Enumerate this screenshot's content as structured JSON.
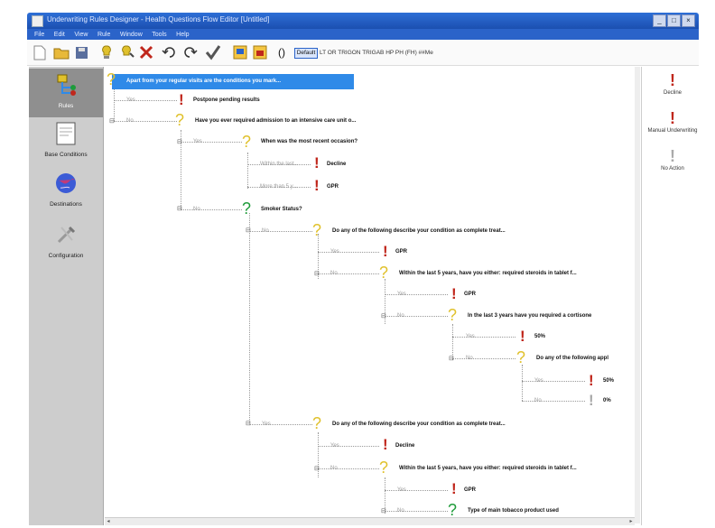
{
  "window": {
    "title": "Underwriting Rules Designer - Health Questions Flow Editor [Untitled]",
    "controls": [
      "_",
      "□",
      "×"
    ]
  },
  "menubar": {
    "items": [
      "File",
      "Edit",
      "View",
      "Rule",
      "Window",
      "Tools",
      "Help"
    ]
  },
  "toolbar": {
    "default_label": "Default",
    "format_text": "LT OR TRIGON TRIGAB HP PH (FH) ##Me"
  },
  "sidebar": {
    "items": [
      {
        "label": "Rules",
        "icon": "rules-icon",
        "selected": true
      },
      {
        "label": "Base Conditions",
        "icon": "notepad-icon",
        "selected": false
      },
      {
        "label": "Destinations",
        "icon": "globe-icon",
        "selected": false
      },
      {
        "label": "Configuration",
        "icon": "tools-icon",
        "selected": false
      }
    ]
  },
  "tree": {
    "root_question": "Apart from your regular visits are the conditions you mark...",
    "nodes": [
      {
        "id": "n1",
        "edge": "Yes",
        "type": "result",
        "text": "Postpone pending results"
      },
      {
        "id": "n2",
        "edge": "No",
        "type": "question",
        "text": "Have you ever required admission to an intensive care unit o..."
      },
      {
        "id": "n3",
        "edge": "Yes",
        "type": "question",
        "text": "When was the most recent occasion?"
      },
      {
        "id": "n4",
        "edge": "Within the last...",
        "type": "result",
        "text": "Decline"
      },
      {
        "id": "n5",
        "edge": "More than 5 y...",
        "type": "result",
        "text": "GPR"
      },
      {
        "id": "n6",
        "edge": "No",
        "type": "question-green",
        "text": "Smoker Status?"
      },
      {
        "id": "n7",
        "edge": "No",
        "type": "question",
        "text": "Do any of the following describe your condition as complete treat..."
      },
      {
        "id": "n8",
        "edge": "Yes",
        "type": "result",
        "text": "GPR"
      },
      {
        "id": "n9",
        "edge": "No",
        "type": "question",
        "text": "Within the last 5 years, have you either: required steroids in tablet f..."
      },
      {
        "id": "n10",
        "edge": "Yes",
        "type": "result",
        "text": "GPR"
      },
      {
        "id": "n11",
        "edge": "No",
        "type": "question",
        "text": "In the last 3 years have you required a cortisone"
      },
      {
        "id": "n12",
        "edge": "Yes",
        "type": "result",
        "text": "50%"
      },
      {
        "id": "n13",
        "edge": "No",
        "type": "question",
        "text": "Do any of the following appl"
      },
      {
        "id": "n14",
        "edge": "Yes",
        "type": "result",
        "text": "50%"
      },
      {
        "id": "n15",
        "edge": "No",
        "type": "result-gray",
        "text": "0%"
      },
      {
        "id": "n16",
        "edge": "Yes",
        "type": "question",
        "text": "Do any of the following describe your condition as complete treat..."
      },
      {
        "id": "n17",
        "edge": "Yes",
        "type": "result",
        "text": "Decline"
      },
      {
        "id": "n18",
        "edge": "No",
        "type": "question",
        "text": "Within the last 5 years, have you either: required steroids in tablet f..."
      },
      {
        "id": "n19",
        "edge": "Yes",
        "type": "result",
        "text": "GPR"
      },
      {
        "id": "n20",
        "edge": "No",
        "type": "question-green",
        "text": "Type of main tobacco product used"
      }
    ]
  },
  "right_panel": {
    "items": [
      {
        "label": "Decline",
        "icon": "red-exclamation-icon"
      },
      {
        "label": "Manual Underwriting",
        "icon": "red-exclamation-icon"
      },
      {
        "label": "No Action",
        "icon": "gray-exclamation-icon"
      }
    ]
  },
  "colors": {
    "title_bar": "#1b4fb0",
    "selection": "#2f8ae8",
    "result_red": "#c0271c",
    "question_yellow": "#e0c12c",
    "question_green": "#1f9b3a"
  }
}
